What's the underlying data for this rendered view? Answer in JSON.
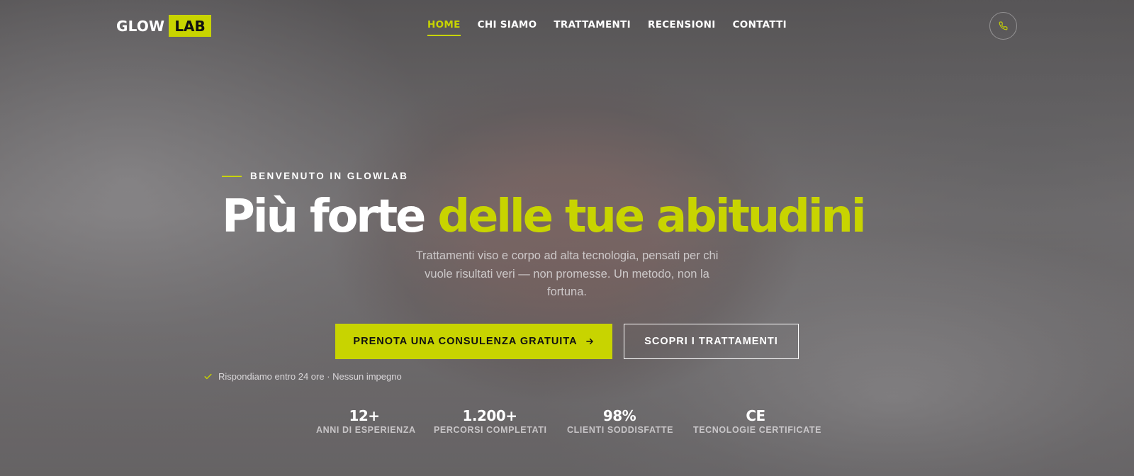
{
  "brand": {
    "logo_word1": "GLOW",
    "logo_word2": "LAB",
    "accent_color": "#c8d400"
  },
  "nav": {
    "items": [
      {
        "label": "HOME",
        "active": true
      },
      {
        "label": "CHI SIAMO",
        "active": false
      },
      {
        "label": "TRATTAMENTI",
        "active": false
      },
      {
        "label": "RECENSIONI",
        "active": false
      },
      {
        "label": "CONTATTI",
        "active": false
      }
    ],
    "phone_icon": "phone-icon"
  },
  "hero": {
    "eyebrow": "BENVENUTO IN GLOWLAB",
    "headline_white": "Più forte",
    "headline_accent": "delle tue abitudini",
    "subtitle": "Trattamenti viso e corpo ad alta tecnologia, pensati per chi vuole risultati veri — non promesse. Un metodo, non la fortuna.",
    "cta_primary": "PRENOTA UNA CONSULENZA GRATUITA",
    "cta_primary_icon": "arrow-right-icon",
    "cta_secondary": "SCOPRI I TRATTAMENTI",
    "assurance_icon": "check-icon",
    "assurance": "Rispondiamo entro 24 ore · Nessun impegno"
  },
  "stats": [
    {
      "value": "12+",
      "label": "ANNI DI ESPERIENZA"
    },
    {
      "value": "1.200+",
      "label": "PERCORSI COMPLETATI"
    },
    {
      "value": "98%",
      "label": "CLIENTI SODDISFATTE"
    },
    {
      "value": "CE",
      "label": "TECNOLOGIE CERTIFICATE"
    }
  ]
}
